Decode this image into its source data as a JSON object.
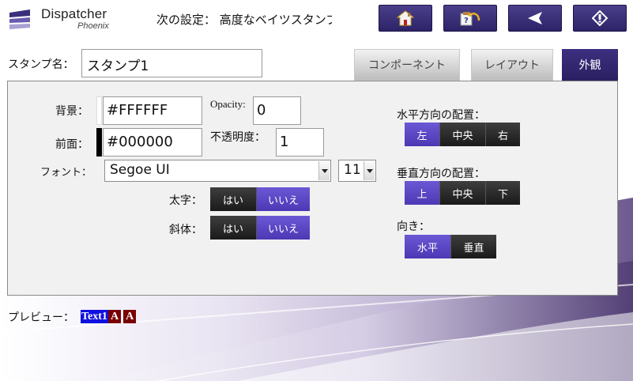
{
  "header": {
    "logo_name": "Dispatcher",
    "logo_sub": "Phoenix",
    "wizard_title": "次の設定： 高度なベイツスタンプ"
  },
  "stamp": {
    "name_label": "スタンプ名：",
    "name_value": "スタンプ1"
  },
  "tabs": [
    {
      "label": "コンポーネント",
      "active": false
    },
    {
      "label": "レイアウト",
      "active": false
    },
    {
      "label": "外観",
      "active": true
    }
  ],
  "appearance": {
    "background_label": "背景：",
    "background_value": "#FFFFFF",
    "foreground_label": "前面：",
    "foreground_value": "#000000",
    "opacity_label": "Opacity:",
    "opacity_value": "0",
    "transparency_label": "不透明度：",
    "transparency_value": "1",
    "font_label": "フォント：",
    "font_value": "Segoe UI",
    "font_size_value": "11",
    "bold_label": "太字：",
    "italic_label": "斜体：",
    "yes": "はい",
    "no": "いいえ"
  },
  "alignment": {
    "horizontal_label": "水平方向の配置：",
    "horizontal_options": [
      "左",
      "中央",
      "右"
    ],
    "horizontal_selected": "左",
    "vertical_label": "垂直方向の配置：",
    "vertical_options": [
      "上",
      "中央",
      "下"
    ],
    "vertical_selected": "上",
    "orientation_label": "向き：",
    "orientation_options": [
      "水平",
      "垂直"
    ],
    "orientation_selected": "水平"
  },
  "preview": {
    "label": "プレビュー：",
    "part1": "Text1",
    "part2": "A",
    "part3": "A"
  },
  "colors": {
    "accent": "#4c38b4",
    "tab_active": "#2a1f61",
    "swatch_background": "#FFFFFF",
    "swatch_foreground": "#000000"
  },
  "icons": {
    "home": "home-icon",
    "back_with_arrow": "undo-icon",
    "back": "back-arrow-icon",
    "next": "diamond-next-icon"
  }
}
